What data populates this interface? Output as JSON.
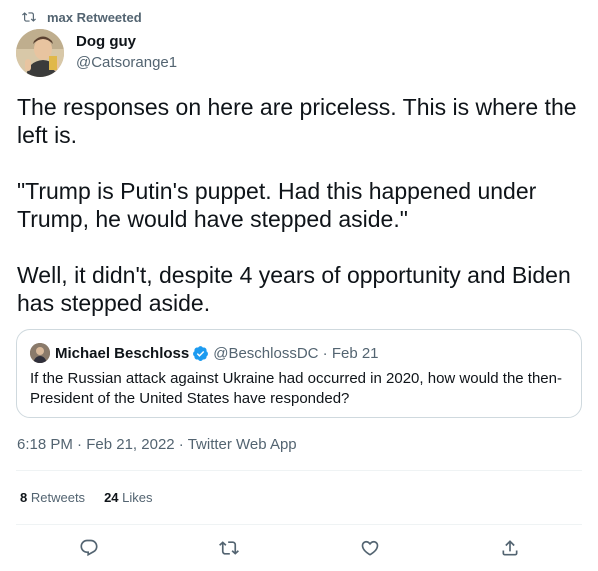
{
  "retweet_notice": {
    "text": "max Retweeted"
  },
  "author": {
    "name": "Dog guy",
    "handle": "@Catsorange1"
  },
  "tweet": {
    "paragraphs": [
      "The responses on here are priceless. This is where the left is.",
      "\"Trump is Putin's puppet. Had this happened under Trump, he would have stepped aside.\"",
      "Well, it didn't, despite 4 years of opportunity and Biden has stepped aside."
    ]
  },
  "quoted_tweet": {
    "name": "Michael Beschloss",
    "handle_date": "@BeschlossDC · Feb 21",
    "text": "If the Russian attack against Ukraine had occurred in 2020, how would the then-President of the United States have responded?"
  },
  "meta": {
    "time": "6:18 PM",
    "date": "Feb 21, 2022",
    "source": "Twitter Web App"
  },
  "stats": {
    "retweets_count": "8",
    "retweets_label": "Retweets",
    "likes_count": "24",
    "likes_label": "Likes"
  },
  "actions": {
    "reply_icon": "reply-icon",
    "retweet_icon": "retweet-icon",
    "like_icon": "heart-icon",
    "share_icon": "share-icon"
  },
  "colors": {
    "text_primary": "#0f1419",
    "text_secondary": "#536471",
    "verified_blue": "#1d9bf0",
    "border": "#cfd9de"
  }
}
